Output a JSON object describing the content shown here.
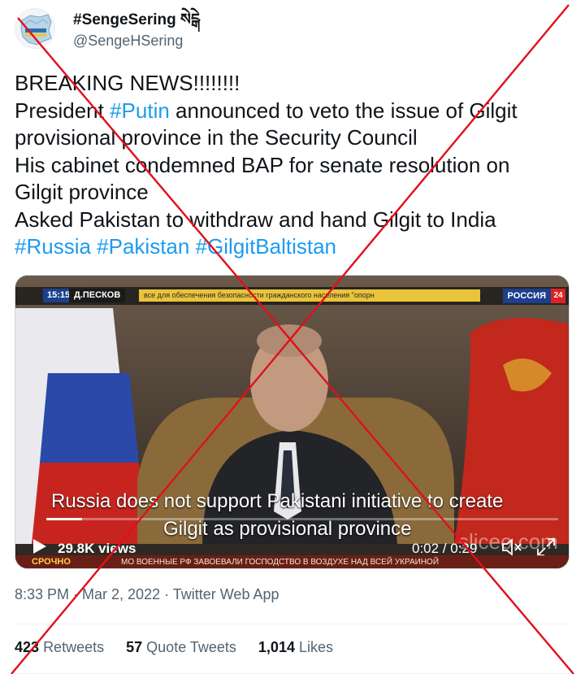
{
  "author": {
    "display_name": "#SengeSering སེངྒེ",
    "handle": "@SengeHSering"
  },
  "tweet": {
    "lines": [
      [
        {
          "text": "BREAKING NEWS!!!!!!!!"
        }
      ],
      [
        {
          "text": "President "
        },
        {
          "text": "#Putin",
          "hashtag": true
        },
        {
          "text": " announced to veto the issue of Gilgit"
        }
      ],
      [
        {
          "text": "provisional province in the Security Council"
        }
      ],
      [
        {
          "text": "His cabinet condemned BAP for senate resolution on"
        }
      ],
      [
        {
          "text": "Gilgit province"
        }
      ],
      [
        {
          "text": "Asked Pakistan to withdraw and hand Gilgit to India"
        }
      ],
      [
        {
          "text": "#Russia",
          "hashtag": true
        },
        {
          "text": " "
        },
        {
          "text": "#Pakistan",
          "hashtag": true
        },
        {
          "text": " "
        },
        {
          "text": "#GilgitBaltistan",
          "hashtag": true
        }
      ]
    ]
  },
  "video": {
    "ticker_time": "15:15",
    "ticker_name": "Д.ПЕСКОВ",
    "ticker_strip": "все для обеспечения безопасности гражданского населения \"опорн",
    "channel": "РОССИЯ",
    "channel_number": "24",
    "subtitle_line1": "Russia does not support Pakistani initiative to create",
    "subtitle_line2": "Gilgit as provisional province",
    "views": "29.8K views",
    "timecode": "0:02 / 0:29",
    "progress_fraction": 0.07,
    "lower_tag": "СРОЧНО",
    "lower_text": "МО ВОЕННЫЕ РФ ЗАВОЕВАЛИ ГОСПОДСТВО В ВОЗДУХЕ НАД ВСЕЙ УКРАИНОЙ",
    "watermark": "sliceo.com"
  },
  "meta": "8:33 PM · Mar 2, 2022 · Twitter Web App",
  "stats": {
    "retweets_count": "423",
    "retweets_label": "Retweets",
    "quotes_count": "57",
    "quotes_label": "Quote Tweets",
    "likes_count": "1,014",
    "likes_label": "Likes"
  },
  "colors": {
    "hashtag": "#1d9bf0",
    "cross": "#e0101a",
    "secondary_text": "#536471"
  }
}
